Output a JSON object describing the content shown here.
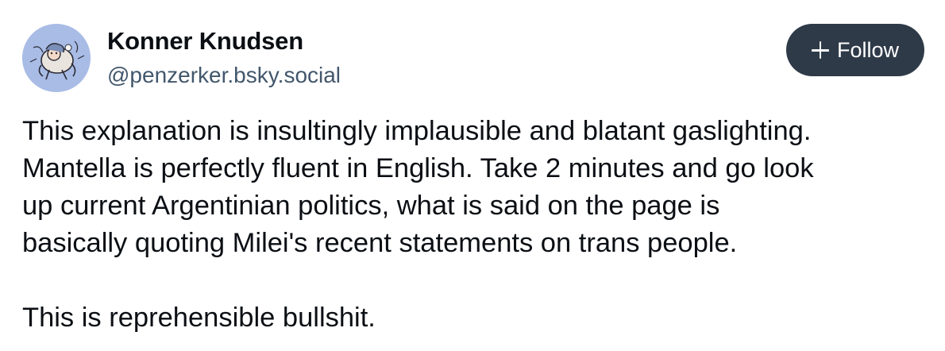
{
  "author": {
    "display_name": "Konner Knudsen",
    "handle": "@penzerker.bsky.social",
    "avatar_icon": "cartoon-character-avatar",
    "avatar_bg": "#a9bce6"
  },
  "follow_button": {
    "label": "Follow",
    "icon": "plus-icon",
    "bg": "#2e3a48"
  },
  "post": {
    "paragraphs": [
      "This explanation is insultingly implausible and blatant gaslighting.\nMantella is perfectly fluent in English. Take 2 minutes and go look\nup current Argentinian politics, what is said on the page is\nbasically quoting Milei's recent statements on trans people.",
      "This is reprehensible bullshit."
    ]
  }
}
